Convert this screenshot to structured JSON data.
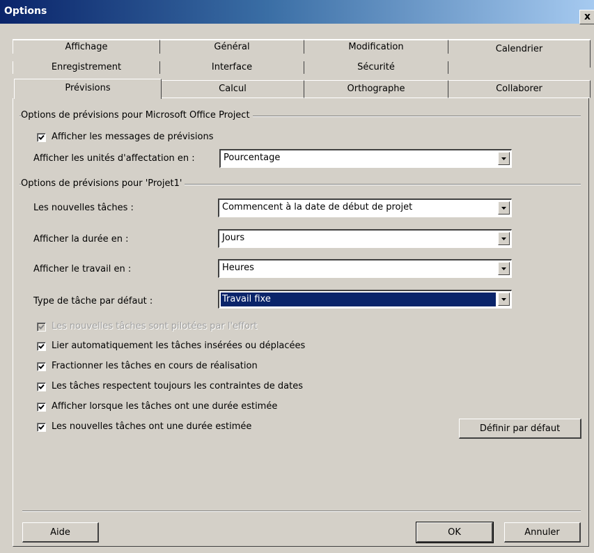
{
  "window": {
    "title": "Options",
    "close_label": "x"
  },
  "tabs": {
    "row1": [
      "Affichage",
      "Général",
      "Modification",
      "Calendrier"
    ],
    "row2": [
      "Enregistrement",
      "Interface",
      "Sécurité"
    ],
    "row3": [
      "Prévisions",
      "Calcul",
      "Orthographe",
      "Collaborer"
    ],
    "active": "Prévisions"
  },
  "group1": {
    "title": "Options de prévisions pour Microsoft Office Project",
    "show_messages": {
      "label": "Afficher les messages de prévisions",
      "checked": true
    },
    "units": {
      "label": "Afficher les unités d'affectation en :",
      "value": "Pourcentage"
    }
  },
  "group2": {
    "title": "Options de prévisions pour 'Projet1'",
    "new_tasks": {
      "label": "Les nouvelles tâches :",
      "value": "Commencent à la date de début de projet"
    },
    "duration": {
      "label": "Afficher la durée en :",
      "value": "Jours"
    },
    "work": {
      "label": "Afficher le travail en :",
      "value": "Heures"
    },
    "task_type": {
      "label": "Type de tâche par défaut :",
      "value": "Travail fixe"
    },
    "checkboxes": [
      {
        "label": "Les nouvelles tâches sont pilotées par l'effort",
        "checked": true,
        "disabled": true
      },
      {
        "label": "Lier automatiquement les tâches insérées ou déplacées",
        "checked": true,
        "disabled": false
      },
      {
        "label": "Fractionner les tâches en cours de réalisation",
        "checked": true,
        "disabled": false
      },
      {
        "label": "Les tâches respectent toujours les contraintes de dates",
        "checked": true,
        "disabled": false
      },
      {
        "label": "Afficher lorsque les tâches ont une durée estimée",
        "checked": true,
        "disabled": false
      },
      {
        "label": "Les nouvelles tâches ont une durée estimée",
        "checked": true,
        "disabled": false
      }
    ],
    "set_default_button": "Définir par défaut"
  },
  "footer": {
    "help": "Aide",
    "ok": "OK",
    "cancel": "Annuler"
  },
  "colors": {
    "face": "#d4d0c8",
    "selection": "#0a246a",
    "title_start": "#0a246a",
    "title_end": "#a6caf0"
  }
}
